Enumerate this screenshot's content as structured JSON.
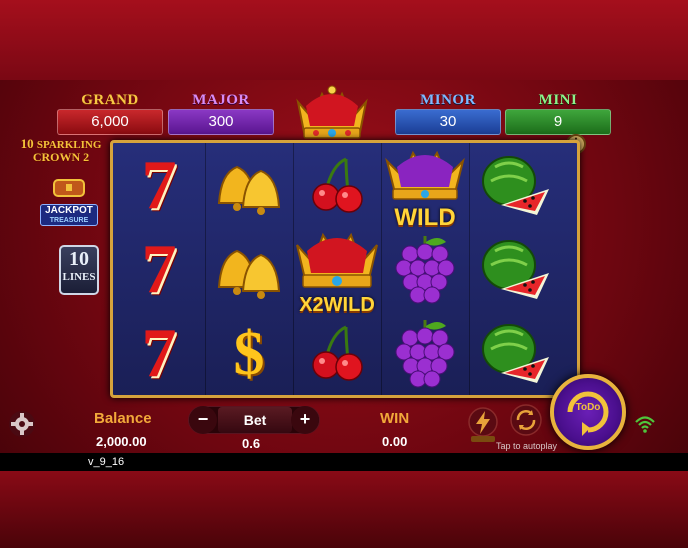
{
  "jackpots": {
    "grand": {
      "label": "GRAND",
      "value": "6,000"
    },
    "major": {
      "label": "MAJOR",
      "value": "300"
    },
    "minor": {
      "label": "MINOR",
      "value": "30"
    },
    "mini": {
      "label": "MINI",
      "value": "9"
    }
  },
  "game_logo": {
    "line1": "10",
    "line2": "SPARKLING",
    "line3": "CROWN 2"
  },
  "jackpot_treasure": {
    "line1": "JACKPOT",
    "line2": "TREASURE"
  },
  "lines": {
    "count": "10",
    "label": "LINES"
  },
  "info_button": "i",
  "symbols": {
    "seven": "7",
    "dollar": "$",
    "wild": "WILD",
    "x2wild": "X2WILD"
  },
  "controls": {
    "balance_label": "Balance",
    "balance_value": "2,000.00",
    "bet_label": "Bet",
    "bet_minus": "−",
    "bet_plus": "+",
    "bet_value": "0.6",
    "win_label": "WIN",
    "win_value": "0.00",
    "autoplay_hint": "Tap to autoplay",
    "spin_label": "ToDo"
  },
  "version": "v_9_16",
  "colors": {
    "background": "#8a0a16",
    "frame_gold": "#d6a33c",
    "reel_bg": "#1f2668",
    "spin_purple": "#4b0f8e"
  }
}
